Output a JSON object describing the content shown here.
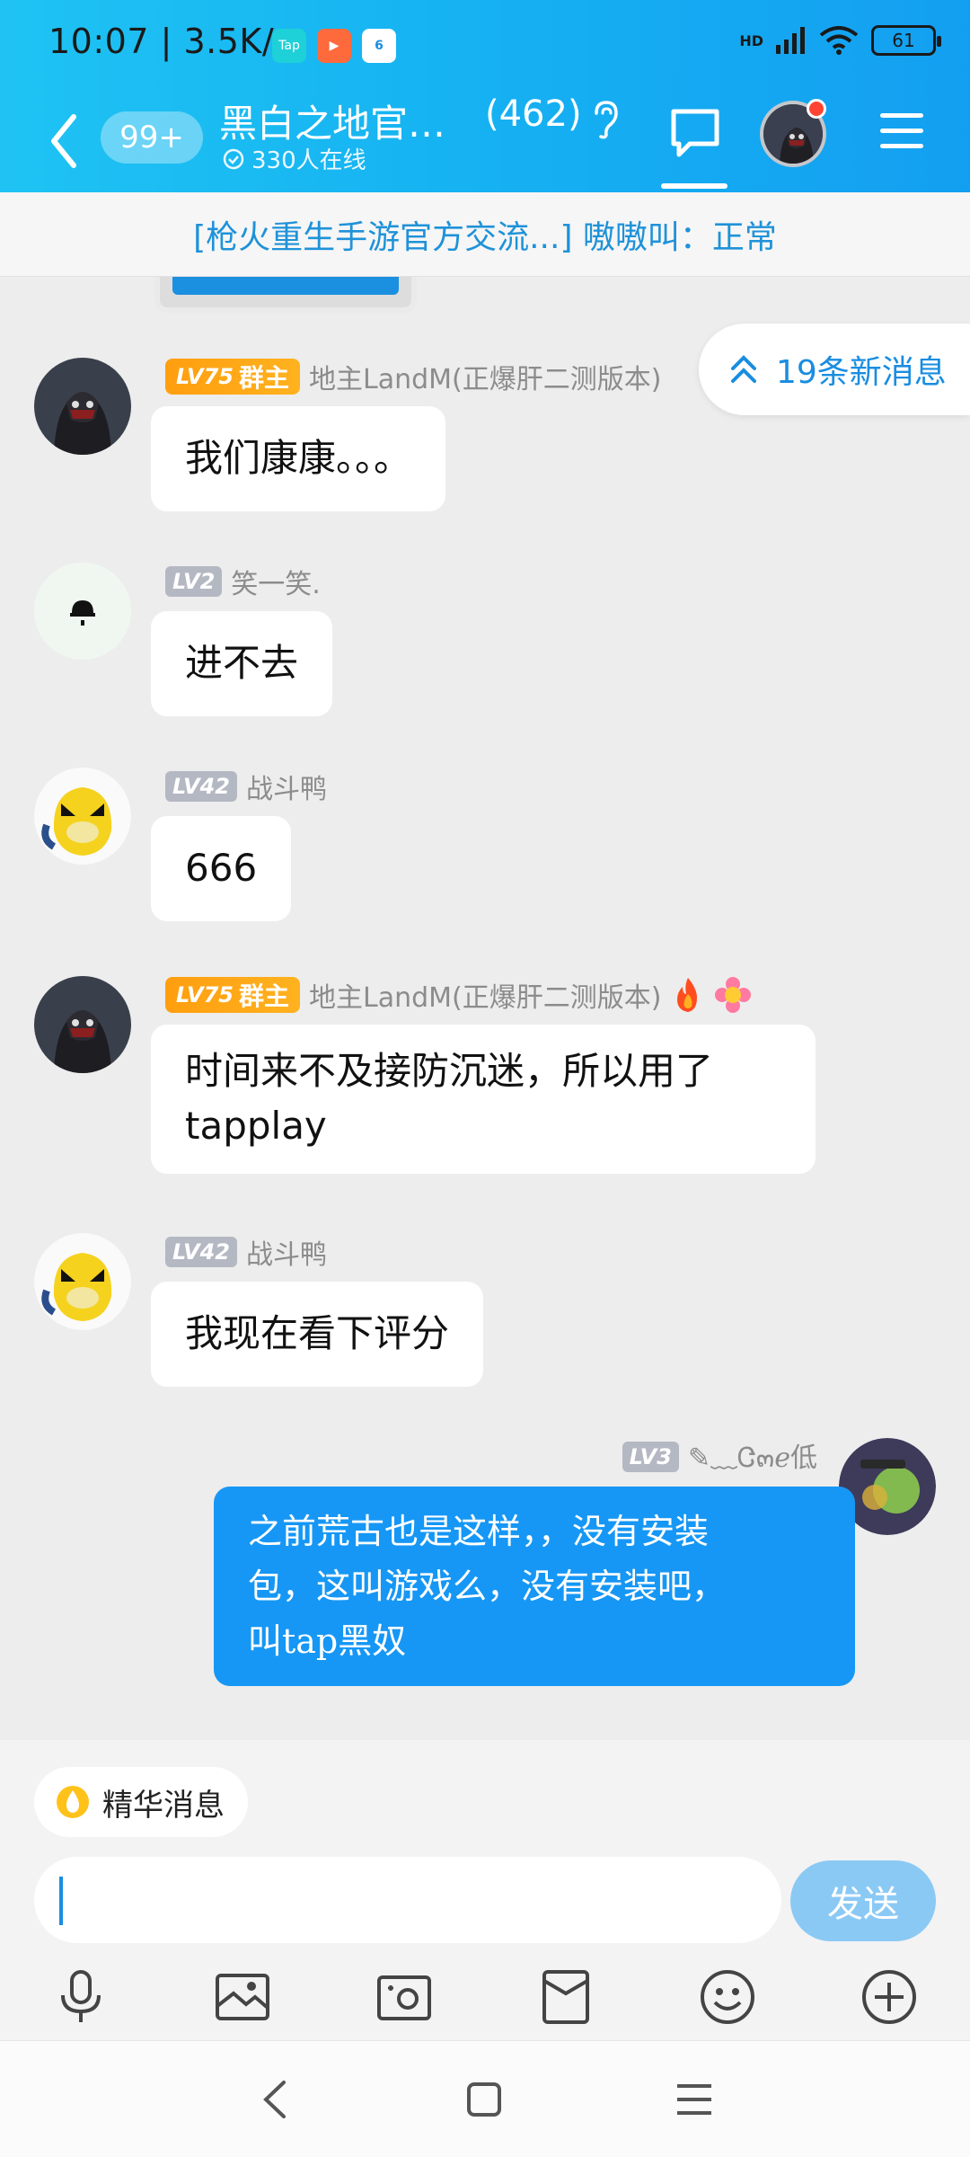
{
  "status_bar": {
    "time": "10:07 | 3.5K/s",
    "apps": [
      "Tap",
      "▶",
      "6"
    ],
    "hd": "HD",
    "battery": "61"
  },
  "header": {
    "unread": "99+",
    "title": "黑白之地官…",
    "member_count": "(462)",
    "online": "330人在线"
  },
  "banner": {
    "text": "[枪火重生手游官方交流...] 嗷嗷叫：正常"
  },
  "new_messages": "19条新消息",
  "messages": [
    {
      "level": "LV75",
      "role": "群主",
      "name": "地主LandM(正爆肝二测版本)",
      "text": "我们康康。。。"
    },
    {
      "level": "LV2",
      "name": "笑一笑.",
      "text": "进不去"
    },
    {
      "level": "LV42",
      "name": "战斗鸭",
      "text": "666"
    },
    {
      "level": "LV75",
      "role": "群主",
      "name": "地主LandM(正爆肝二测版本)",
      "text_line1": "时间来不及接防沉迷，所以用了",
      "text_line2": "tapplay"
    },
    {
      "level": "LV42",
      "name": "战斗鸭",
      "text": "我现在看下评分"
    },
    {
      "level": "LV3",
      "name": "✎﹏Ꮳ๓ℯ低",
      "text_line1": "之前荒古也是这样，，没有安装",
      "text_line2": "包，这叫游戏么，没有安装吧，",
      "text_line3": "叫tap黑奴"
    }
  ],
  "bottom": {
    "essence": "精华消息",
    "input_value": "",
    "send": "发送"
  },
  "colors": {
    "header_gradient_start": "#1fc3f3",
    "header_gradient_end": "#139ff1",
    "accent": "#1a8de0",
    "self_bubble": "#1697f5",
    "owner_badge": "#ff9e0f"
  }
}
